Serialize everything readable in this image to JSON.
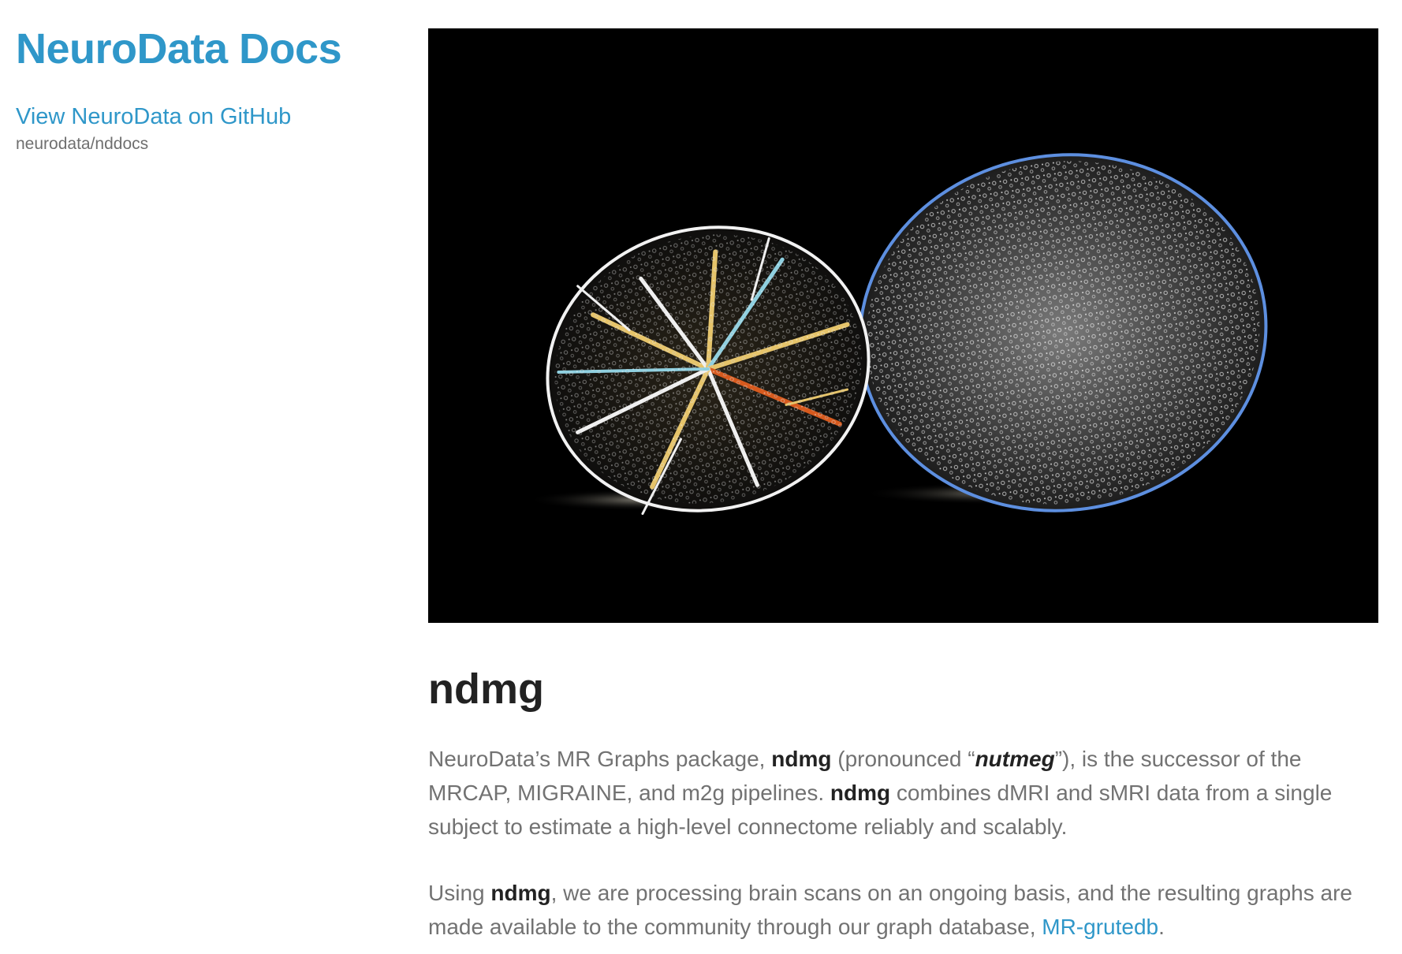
{
  "sidebar": {
    "site_title": "NeuroData Docs",
    "github_link": "View NeuroData on GitHub",
    "repo_name": "neurodata/nddocs"
  },
  "hero": {
    "description": "Edge-filtered photo of a halved nutmeg: cut half with branching pattern on the left, whole seed with speckled surface on the right, on black background"
  },
  "content": {
    "title": "ndmg",
    "para1": {
      "t1": "NeuroData’s MR Graphs package, ",
      "b1": "ndmg",
      "t2": " (pronounced “",
      "em": "nutmeg",
      "t3": "”), is the successor of the MRCAP, MIGRAINE, and m2g pipelines. ",
      "b2": "ndmg",
      "t4": " combines dMRI and sMRI data from a single subject to estimate a high-level connectome reliably and scalably."
    },
    "para2": {
      "t1": "Using ",
      "b1": "ndmg",
      "t2": ", we are processing brain scans on an ongoing basis, and the resulting graphs are made available to the community through our graph database, ",
      "link": "MR-grutedb",
      "t3": "."
    }
  },
  "colors": {
    "link": "#2f97c9",
    "text": "#727272",
    "heading": "#222222",
    "hero_bg": "#000000"
  }
}
